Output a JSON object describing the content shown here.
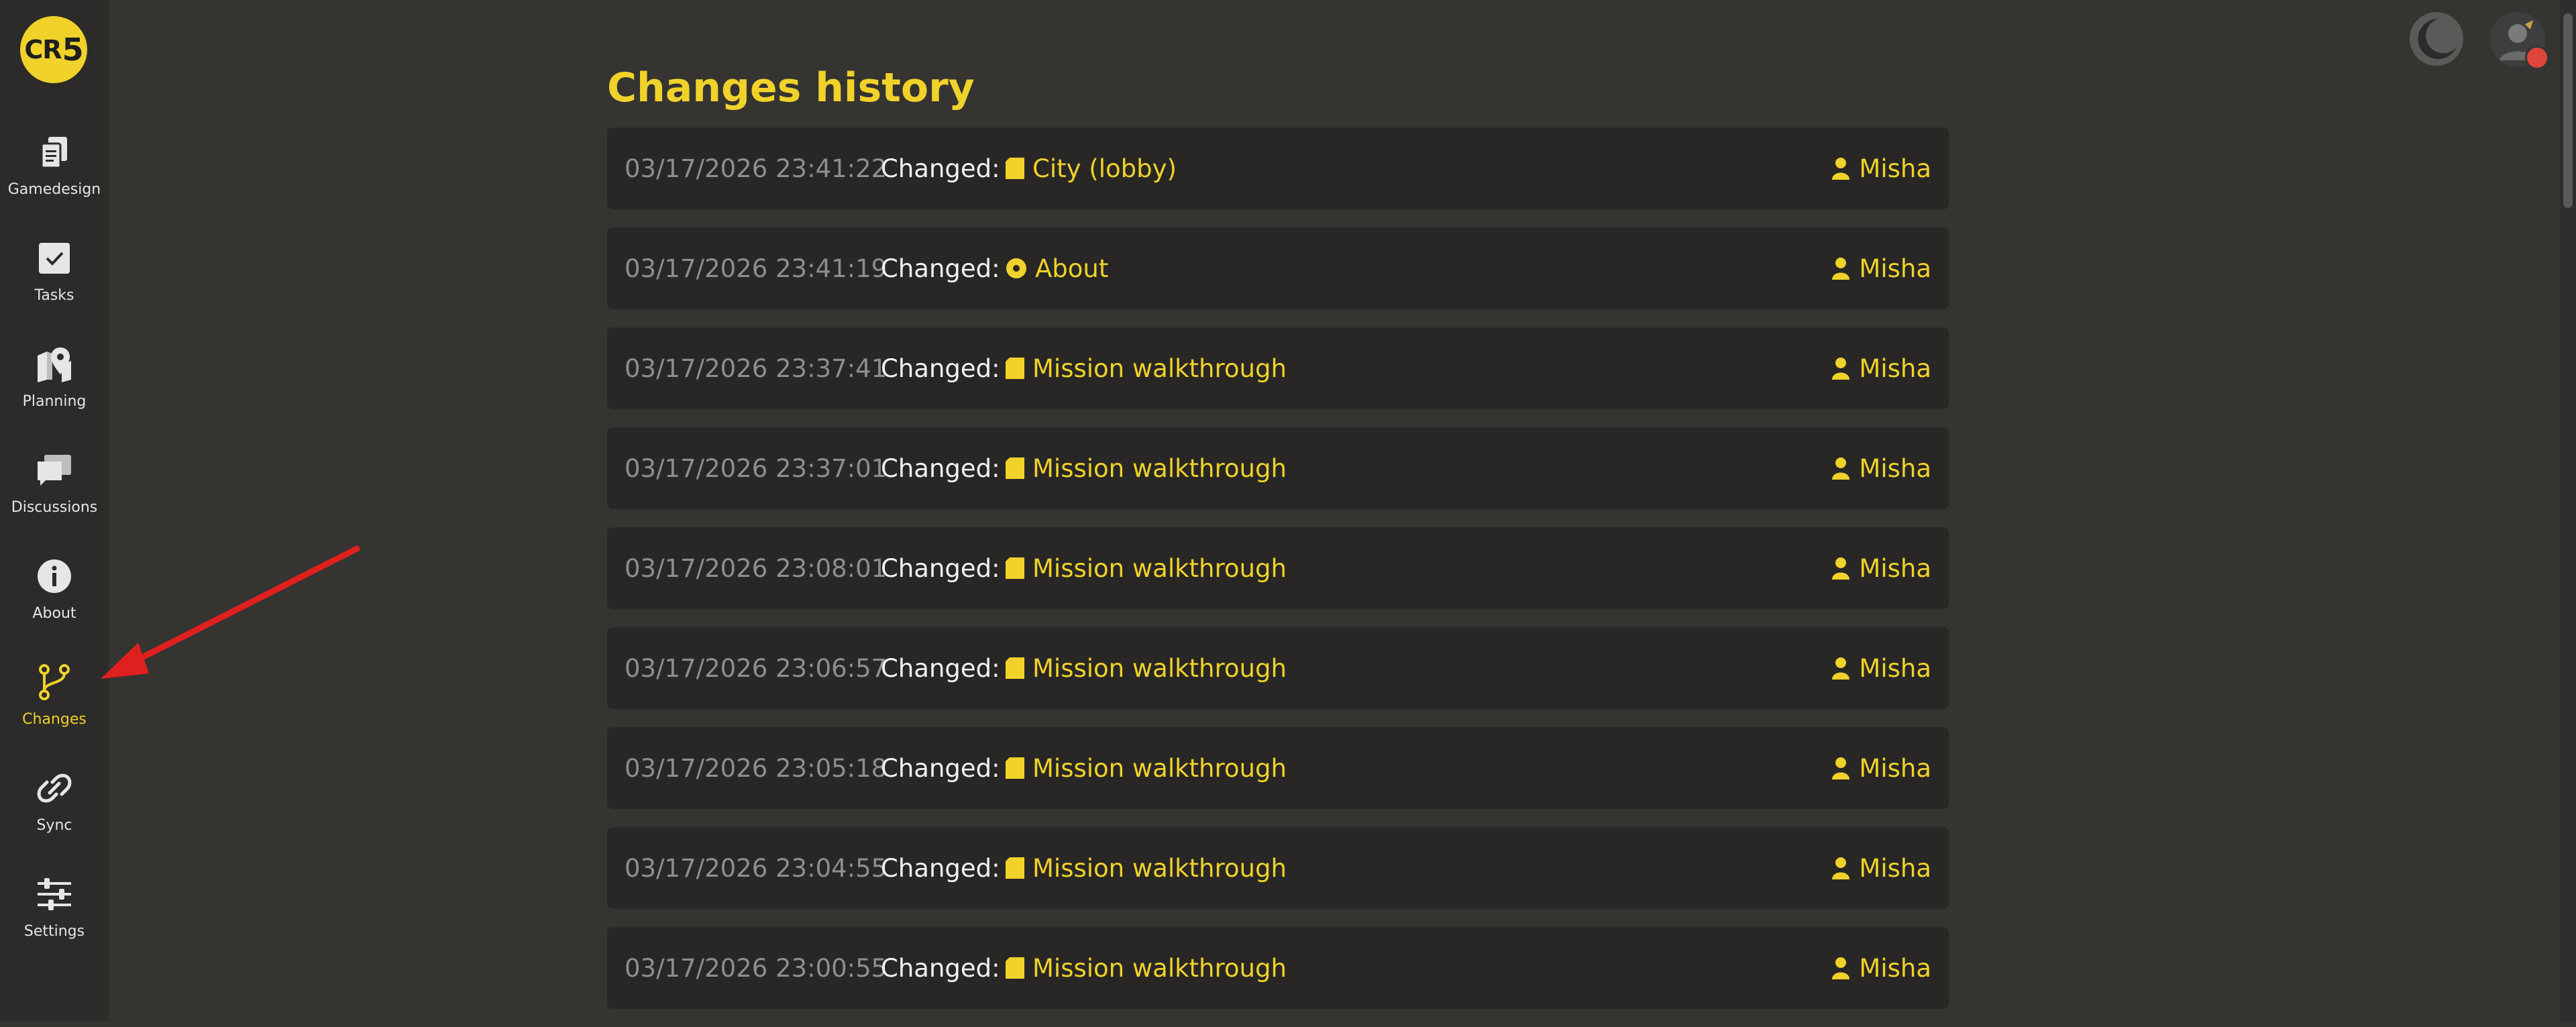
{
  "app": {
    "logo_text": "CR",
    "logo_digit": "5"
  },
  "sidebar": {
    "items": [
      {
        "label": "Gamedesign",
        "icon": "document-copy-icon"
      },
      {
        "label": "Tasks",
        "icon": "checkbox-icon"
      },
      {
        "label": "Planning",
        "icon": "map-pin-icon"
      },
      {
        "label": "Discussions",
        "icon": "chat-bubbles-icon"
      },
      {
        "label": "About",
        "icon": "info-icon"
      },
      {
        "label": "Changes",
        "icon": "branch-icon",
        "active": true
      },
      {
        "label": "Sync",
        "icon": "link-icon"
      },
      {
        "label": "Settings",
        "icon": "sliders-icon"
      }
    ]
  },
  "header": {
    "theme_icon": "moon-icon",
    "avatar_icon": "user-avatar"
  },
  "main": {
    "title": "Changes history",
    "entries": [
      {
        "timestamp": "03/17/2026 23:41:22",
        "action": "Changed:",
        "target": "City (lobby)",
        "target_icon": "document-icon",
        "user": "Misha"
      },
      {
        "timestamp": "03/17/2026 23:41:19",
        "action": "Changed:",
        "target": "About",
        "target_icon": "info-dot-icon",
        "user": "Misha"
      },
      {
        "timestamp": "03/17/2026 23:37:41",
        "action": "Changed:",
        "target": "Mission walkthrough",
        "target_icon": "document-icon",
        "user": "Misha"
      },
      {
        "timestamp": "03/17/2026 23:37:01",
        "action": "Changed:",
        "target": "Mission walkthrough",
        "target_icon": "document-icon",
        "user": "Misha"
      },
      {
        "timestamp": "03/17/2026 23:08:01",
        "action": "Changed:",
        "target": "Mission walkthrough",
        "target_icon": "document-icon",
        "user": "Misha"
      },
      {
        "timestamp": "03/17/2026 23:06:57",
        "action": "Changed:",
        "target": "Mission walkthrough",
        "target_icon": "document-icon",
        "user": "Misha"
      },
      {
        "timestamp": "03/17/2026 23:05:18",
        "action": "Changed:",
        "target": "Mission walkthrough",
        "target_icon": "document-icon",
        "user": "Misha"
      },
      {
        "timestamp": "03/17/2026 23:04:55",
        "action": "Changed:",
        "target": "Mission walkthrough",
        "target_icon": "document-icon",
        "user": "Misha"
      },
      {
        "timestamp": "03/17/2026 23:00:55",
        "action": "Changed:",
        "target": "Mission walkthrough",
        "target_icon": "document-icon",
        "user": "Misha"
      }
    ]
  },
  "colors": {
    "accent": "#f0d22a",
    "background": "#353431",
    "sidebar": "#2c2b29",
    "row": "#282725",
    "annotation_arrow": "#e0201f"
  }
}
